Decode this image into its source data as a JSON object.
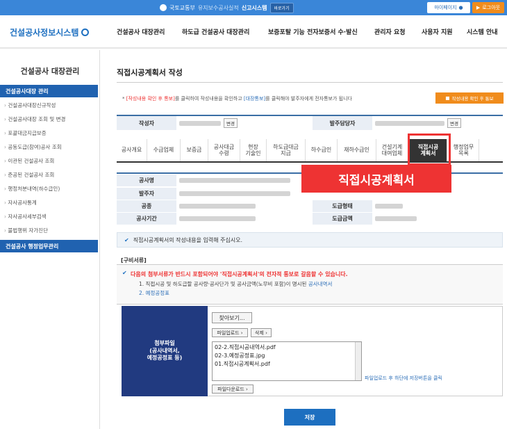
{
  "topbar": {
    "org": "국토교통부",
    "sub": "유지보수공사실적",
    "system": "신고시스템",
    "mini": "바로가기",
    "mypage": "마이페이지",
    "logout": "로그아웃"
  },
  "header": {
    "logo": "건설공사정보시스템",
    "nav": [
      "건설공사 대장관리",
      "하도급 건설공사 대장관리",
      "보증포탈 기능 전자보증서 수·발신",
      "관리자 요청",
      "사용자 지원",
      "시스템 안내"
    ]
  },
  "sidebar": {
    "title": "건설공사 대장관리",
    "section1": "건설공사대장 관리",
    "items": [
      "건설공사대장신규작성",
      "건설공사대장 조회 및 변경",
      "포괄대금지급보증",
      "공동도급(참여)공사 조회",
      "이관된 건설공사 조회",
      "준공된 건설공사 조회",
      "행정처분내역(하수급인)",
      "자사공사통계",
      "자사공사세부검색",
      "불법행위 자가진단"
    ],
    "section2": "건설공사 행정업무관리"
  },
  "main": {
    "title": "직접시공계획서 작성",
    "notice_hl1": "[작성내용 확인 후 통보]",
    "notice_t1": "를 클릭하여 작성내용을 확인하고",
    "notice_bl": "[대장통보]",
    "notice_t2": "를 클릭해야 발주자에게 전자통보가 됩니다",
    "notice_btn": "작성내용 확인 후 통보",
    "info1": {
      "writer_label": "작성자",
      "change": "변경",
      "manager_label": "발주담당자"
    },
    "tabs": [
      "공사개요",
      "수급업체",
      "보증금",
      "공사대금\n수령",
      "현장\n기술인",
      "하도급대금\n지급",
      "하수급인",
      "재하수급인",
      "건설기계\n대여업체",
      "직접시공\n계획서",
      "행정업무\n목록"
    ],
    "overlay": "직접시공계획서",
    "info2": {
      "name_label": "공사명",
      "owner_label": "발주자",
      "type_label": "공종",
      "form_label": "도급형태",
      "period_label": "공사기간",
      "amount_label": "도급금액"
    },
    "instruction": "직접시공계획서의 작성내용을 입력해 주십시오.",
    "docs_label": "[구비서류]",
    "req_main": "다음의 첨부서류가 반드시 포함되어야 '직접시공계획서'의 전자적 통보로 갈음할 수 있습니다.",
    "req1a": "1. 직접시공 및 하도급할 공사량·공사단가 및 공사금액(노무비 포함)이 명시된",
    "req1b": "공사내역서",
    "req2": "2. 예정공정표",
    "attach_label": "첨부파일\n(공사내역서,\n예정공정표 등)",
    "browse": "찾아보기...",
    "upload": "파일업로드",
    "delete": "삭제",
    "files": [
      "02-2.직접시공내역서.pdf",
      "02-3.예정공정표.jpg",
      "01.직접시공계획서.pdf"
    ],
    "upload_note": "파일업로드 후 하단에 저장버튼을 클릭",
    "download": "파일다운로드",
    "save": "저장"
  },
  "colors": {
    "primary": "#1d6fc0",
    "navy": "#213a80",
    "alert": "#e33333",
    "orange": "#f08c1c"
  }
}
